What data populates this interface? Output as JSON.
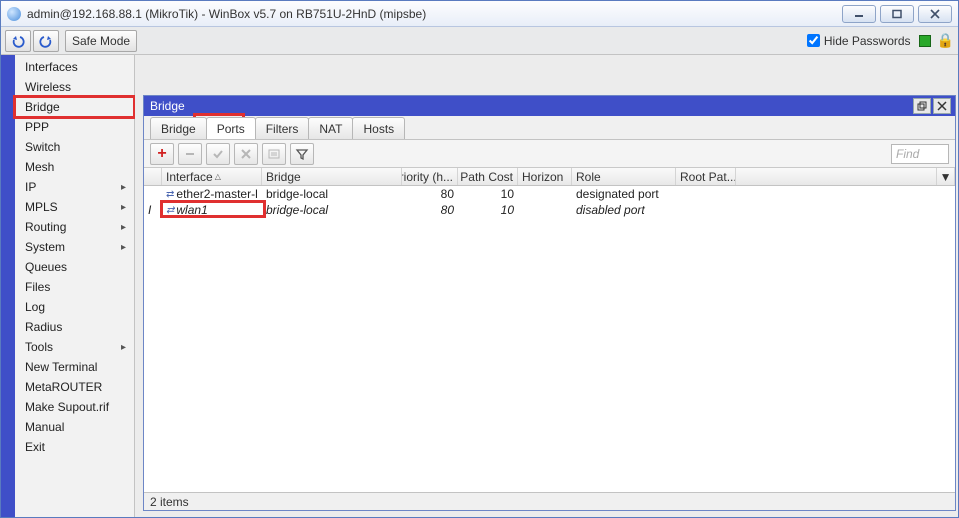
{
  "window": {
    "title": "admin@192.168.88.1 (MikroTik) - WinBox v5.7 on RB751U-2HnD (mipsbe)"
  },
  "toolbar": {
    "safe_mode": "Safe Mode",
    "hide_passwords": "Hide Passwords"
  },
  "menu": {
    "items": [
      {
        "label": "Interfaces",
        "arrow": false
      },
      {
        "label": "Wireless",
        "arrow": false
      },
      {
        "label": "Bridge",
        "arrow": false,
        "highlight": true
      },
      {
        "label": "PPP",
        "arrow": false
      },
      {
        "label": "Switch",
        "arrow": false
      },
      {
        "label": "Mesh",
        "arrow": false
      },
      {
        "label": "IP",
        "arrow": true
      },
      {
        "label": "MPLS",
        "arrow": true
      },
      {
        "label": "Routing",
        "arrow": true
      },
      {
        "label": "System",
        "arrow": true
      },
      {
        "label": "Queues",
        "arrow": false
      },
      {
        "label": "Files",
        "arrow": false
      },
      {
        "label": "Log",
        "arrow": false
      },
      {
        "label": "Radius",
        "arrow": false
      },
      {
        "label": "Tools",
        "arrow": true
      },
      {
        "label": "New Terminal",
        "arrow": false
      },
      {
        "label": "MetaROUTER",
        "arrow": false
      },
      {
        "label": "Make Supout.rif",
        "arrow": false
      },
      {
        "label": "Manual",
        "arrow": false
      },
      {
        "label": "Exit",
        "arrow": false
      }
    ]
  },
  "inner": {
    "title": "Bridge",
    "tabs": [
      "Bridge",
      "Ports",
      "Filters",
      "NAT",
      "Hosts"
    ],
    "active_tab": 1,
    "find_placeholder": "Find",
    "columns": {
      "interface": "Interface",
      "bridge": "Bridge",
      "priority": "Priority (h...",
      "path_cost": "Path Cost",
      "horizon": "Horizon",
      "role": "Role",
      "root_path": "Root Pat..."
    },
    "rows": [
      {
        "mark": "",
        "interface": "ether2-master-l",
        "bridge": "bridge-local",
        "priority": "80",
        "path_cost": "10",
        "horizon": "",
        "role": "designated port",
        "root": ""
      },
      {
        "mark": "I",
        "interface": "wlan1",
        "bridge": "bridge-local",
        "priority": "80",
        "path_cost": "10",
        "horizon": "",
        "role": "disabled port",
        "root": "",
        "italic": true,
        "highlight": true
      }
    ],
    "status": "2 items"
  }
}
